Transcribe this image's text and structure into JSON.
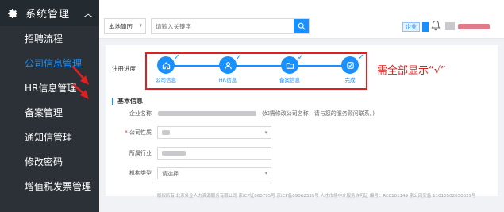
{
  "sidebar": {
    "title": "系统管理",
    "items": [
      {
        "label": "招聘流程"
      },
      {
        "label": "公司信息管理"
      },
      {
        "label": "HR信息管理"
      },
      {
        "label": "备案管理"
      },
      {
        "label": "通知信管理"
      },
      {
        "label": "修改密码"
      },
      {
        "label": "增值税发票管理"
      }
    ],
    "active_index": 1
  },
  "topbar": {
    "select_value": "本地简历",
    "search_placeholder": "请输入关键字",
    "enterprise_badge": "企业"
  },
  "progress": {
    "label": "注册进度",
    "steps": [
      {
        "label": "公司信息",
        "icon": "home-icon",
        "done": true
      },
      {
        "label": "HR信息",
        "icon": "person-icon",
        "done": true
      },
      {
        "label": "备案信息",
        "icon": "folder-icon",
        "done": true
      },
      {
        "label": "完成",
        "icon": "check-icon",
        "done": true
      }
    ],
    "annotation": "需全部显示“√”"
  },
  "basic_info": {
    "section_title": "基本信息",
    "company_name_label": "企业名称",
    "company_name_hint": "(如需修改公司名称，请与您的服务顾问联系。)",
    "company_type_label": "公司性质",
    "industry_label": "所属行业",
    "org_type_label": "机构类型",
    "org_type_placeholder": "请选择"
  },
  "footer": {
    "text": "版权所有  北京外企人力资源服务有限公司  京ICP证060795号   京ICP备09062339号   人才市场中介服务许可证 编号：RC0101149 京公网安备 11010502030629号"
  },
  "colors": {
    "accent": "#1890ff",
    "sidebar_bg": "#2b3137",
    "annotation": "#e02020"
  }
}
